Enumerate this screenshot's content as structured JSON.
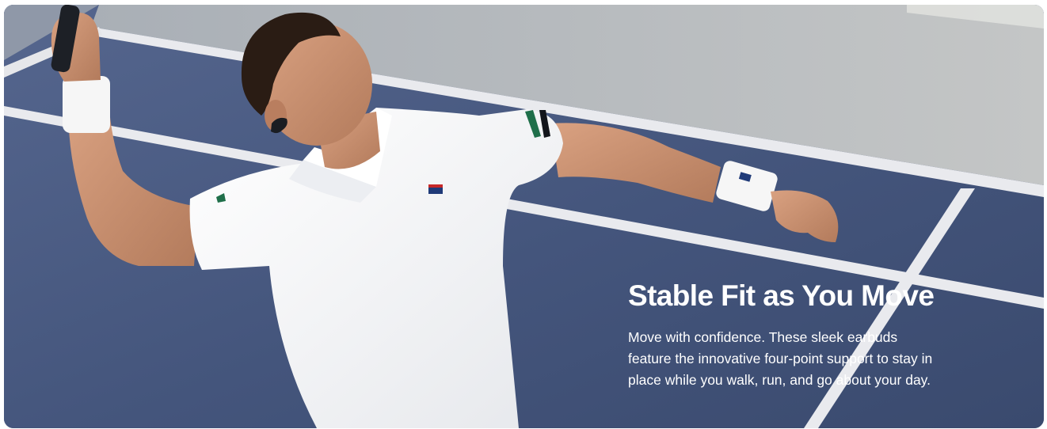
{
  "banner": {
    "title": "Stable Fit as You Move",
    "body_lines": [
      "Move with confidence. These sleek earbuds",
      "feature the innovative four-point support to stay in",
      "place while you walk, run, and go about your day."
    ],
    "photo": {
      "subject": "tennis player swinging racket wearing earbud",
      "colors": {
        "court": "#44557c",
        "court_outer": "#b9bcbe",
        "lines": "#e9eaee",
        "shirt": "#f3f4f6",
        "skin": "#c58d6c",
        "hair": "#2a1c14"
      }
    }
  }
}
